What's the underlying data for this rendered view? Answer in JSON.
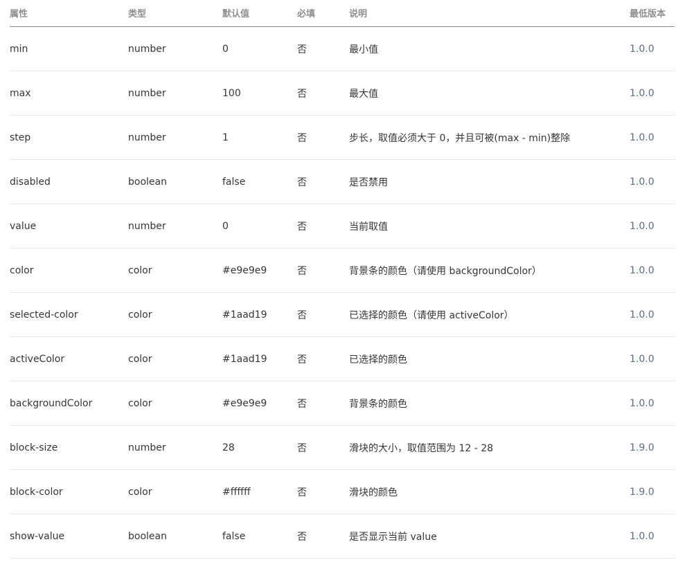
{
  "table": {
    "headers": {
      "attr": "属性",
      "type": "类型",
      "default": "默认值",
      "required": "必填",
      "desc": "说明",
      "version": "最低版本"
    },
    "rows": [
      {
        "attr": "min",
        "type": "number",
        "default": "0",
        "required": "否",
        "desc": "最小值",
        "version": "1.0.0"
      },
      {
        "attr": "max",
        "type": "number",
        "default": "100",
        "required": "否",
        "desc": "最大值",
        "version": "1.0.0"
      },
      {
        "attr": "step",
        "type": "number",
        "default": "1",
        "required": "否",
        "desc": "步长，取值必须大于 0，并且可被(max - min)整除",
        "version": "1.0.0"
      },
      {
        "attr": "disabled",
        "type": "boolean",
        "default": "false",
        "required": "否",
        "desc": "是否禁用",
        "version": "1.0.0"
      },
      {
        "attr": "value",
        "type": "number",
        "default": "0",
        "required": "否",
        "desc": "当前取值",
        "version": "1.0.0"
      },
      {
        "attr": "color",
        "type": "color",
        "default": "#e9e9e9",
        "required": "否",
        "desc": "背景条的颜色（请使用 backgroundColor）",
        "version": "1.0.0"
      },
      {
        "attr": "selected-color",
        "type": "color",
        "default": "#1aad19",
        "required": "否",
        "desc": "已选择的颜色（请使用 activeColor）",
        "version": "1.0.0"
      },
      {
        "attr": "activeColor",
        "type": "color",
        "default": "#1aad19",
        "required": "否",
        "desc": "已选择的颜色",
        "version": "1.0.0"
      },
      {
        "attr": "backgroundColor",
        "type": "color",
        "default": "#e9e9e9",
        "required": "否",
        "desc": "背景条的颜色",
        "version": "1.0.0"
      },
      {
        "attr": "block-size",
        "type": "number",
        "default": "28",
        "required": "否",
        "desc": "滑块的大小，取值范围为 12 - 28",
        "version": "1.9.0"
      },
      {
        "attr": "block-color",
        "type": "color",
        "default": "#ffffff",
        "required": "否",
        "desc": "滑块的颜色",
        "version": "1.9.0"
      },
      {
        "attr": "show-value",
        "type": "boolean",
        "default": "false",
        "required": "否",
        "desc": "是否显示当前 value",
        "version": "1.0.0"
      }
    ]
  },
  "colors": {
    "text": "#353535",
    "header_text": "#8f8f8f",
    "version_link": "#576b95",
    "row_divider": "#e5e5e5",
    "header_divider": "#8a8a8a"
  }
}
